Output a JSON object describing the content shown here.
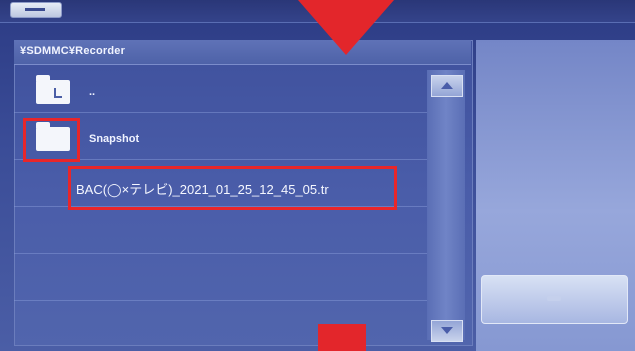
{
  "header": {
    "path": "¥SDMMC¥Recorder"
  },
  "file_list": {
    "items": [
      {
        "label": "..",
        "icon": "folder-up-icon"
      },
      {
        "label": "Snapshot",
        "icon": "folder-icon"
      },
      {
        "label": "BAC(◯×テレビ)_2021_01_25_12_45_05.tr",
        "icon": ""
      }
    ]
  },
  "colors": {
    "background": "#3f519d",
    "highlight": "#e8262a",
    "text": "#f5f7ff"
  }
}
